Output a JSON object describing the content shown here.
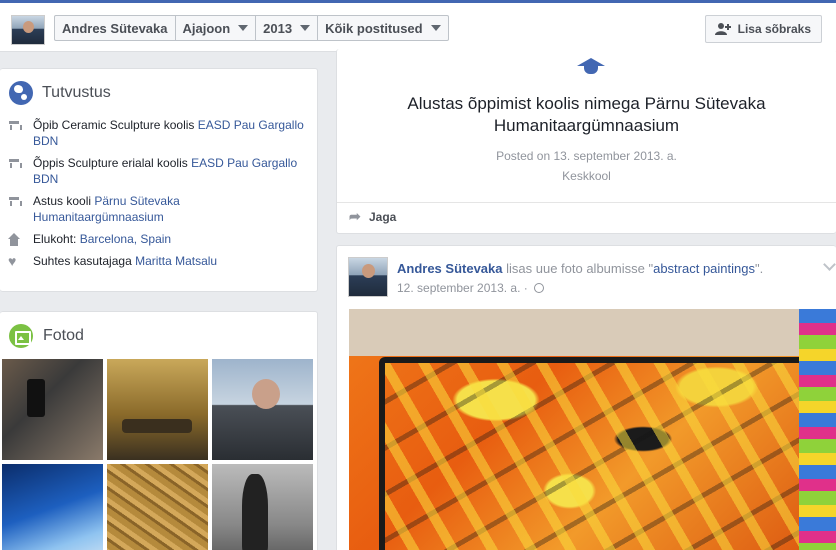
{
  "topbar": {
    "profile_name": "Andres Sütevaka",
    "crumbs": [
      "Ajajoon",
      "2013",
      "Kõik postitused"
    ],
    "add_friend_label": "Lisa sõbraks"
  },
  "intro": {
    "title": "Tutvustus",
    "items": [
      {
        "icon": "school-icon",
        "text": "Õpib Ceramic Sculpture koolis ",
        "link": "EASD Pau Gargallo BDN"
      },
      {
        "icon": "school-icon",
        "text": "Õppis Sculpture erialal koolis ",
        "link": "EASD Pau Gargallo BDN"
      },
      {
        "icon": "school-icon",
        "text": "Astus kooli ",
        "link": "Pärnu Sütevaka Humanitaargümnaasium"
      },
      {
        "icon": "home-icon",
        "text": "Elukoht: ",
        "link": "Barcelona, Spain"
      },
      {
        "icon": "heart-icon",
        "text": "Suhtes kasutajaga ",
        "link": "Maritta Matsalu"
      }
    ]
  },
  "photos": {
    "title": "Fotod"
  },
  "life_event": {
    "title": "Alustas õppimist koolis nimega Pärnu Sütevaka Humanitaargümnaasium",
    "posted_prefix": "Posted on ",
    "posted_date": "13. september 2013. a.",
    "category": "Keskkool",
    "share_label": "Jaga"
  },
  "post": {
    "author": "Andres Sütevaka",
    "action": " lisas uue foto albumisse \"",
    "album": "abstract paintings",
    "action_end": "\".",
    "date": "12. september 2013. a. · "
  },
  "colors": {
    "brand": "#4267b2",
    "link": "#365899",
    "photos_icon": "#7bc143"
  }
}
